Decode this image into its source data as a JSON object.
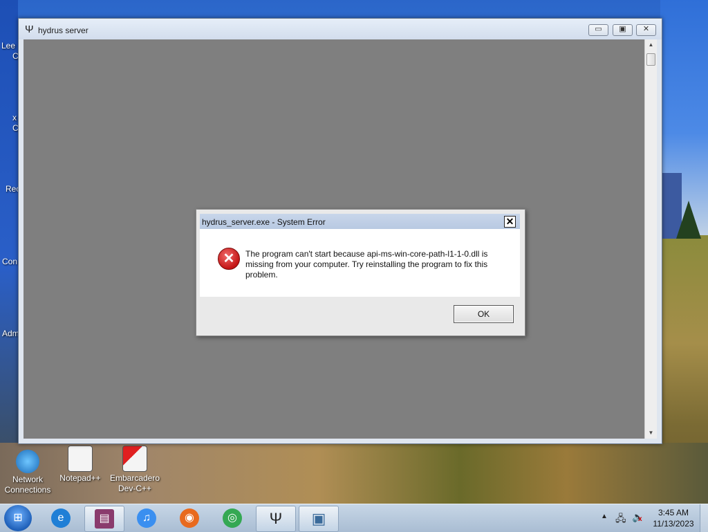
{
  "desktop": {
    "edge_labels": [
      "Lee",
      "C",
      "x",
      "C",
      "Rec",
      "Con",
      "Adm"
    ],
    "icons": [
      {
        "label_line1": "Network",
        "label_line2": "Connections"
      },
      {
        "label_line1": "Notepad++",
        "label_line2": ""
      },
      {
        "label_line1": "Embarcadero",
        "label_line2": "Dev-C++"
      }
    ]
  },
  "window": {
    "title": "hydrus server",
    "app_glyph": "Ψ",
    "buttons": {
      "minimize": "▭",
      "maximize": "▣",
      "close": "✕"
    },
    "scroll_up": "▲",
    "scroll_down": "▼"
  },
  "dialog": {
    "title": "hydrus_server.exe - System Error",
    "close_glyph": "✕",
    "icon": "error-icon",
    "icon_glyph": "✕",
    "message": "The program can't start because api-ms-win-core-path-l1-1-0.dll is missing from your computer. Try reinstalling the program to fix this problem.",
    "ok_label": "OK"
  },
  "taskbar": {
    "items": [
      {
        "name": "internet-explorer",
        "glyph": "e",
        "color": "#1f7fd6"
      },
      {
        "name": "winrar",
        "glyph": "▤",
        "color": "#8a3b6d"
      },
      {
        "name": "itunes",
        "glyph": "♫",
        "color": "#3a8ff0"
      },
      {
        "name": "firefox",
        "glyph": "◉",
        "color": "#e86a1e"
      },
      {
        "name": "chrome",
        "glyph": "◎",
        "color": "#34a853"
      },
      {
        "name": "hydrus",
        "glyph": "Ψ",
        "color": "#333333"
      },
      {
        "name": "dialog-window",
        "glyph": "▣",
        "color": "#3a6a9a"
      }
    ],
    "clock_time": "3:45 AM",
    "clock_date": "11/13/2023",
    "tray_up": "▲",
    "tray_network": "🖧",
    "tray_volume": "🔈",
    "tray_volume_mute": "x"
  },
  "colors": {
    "window_client": "#7f7f7f",
    "dialog_body": "#ffffff",
    "error_red": "#c41616"
  }
}
